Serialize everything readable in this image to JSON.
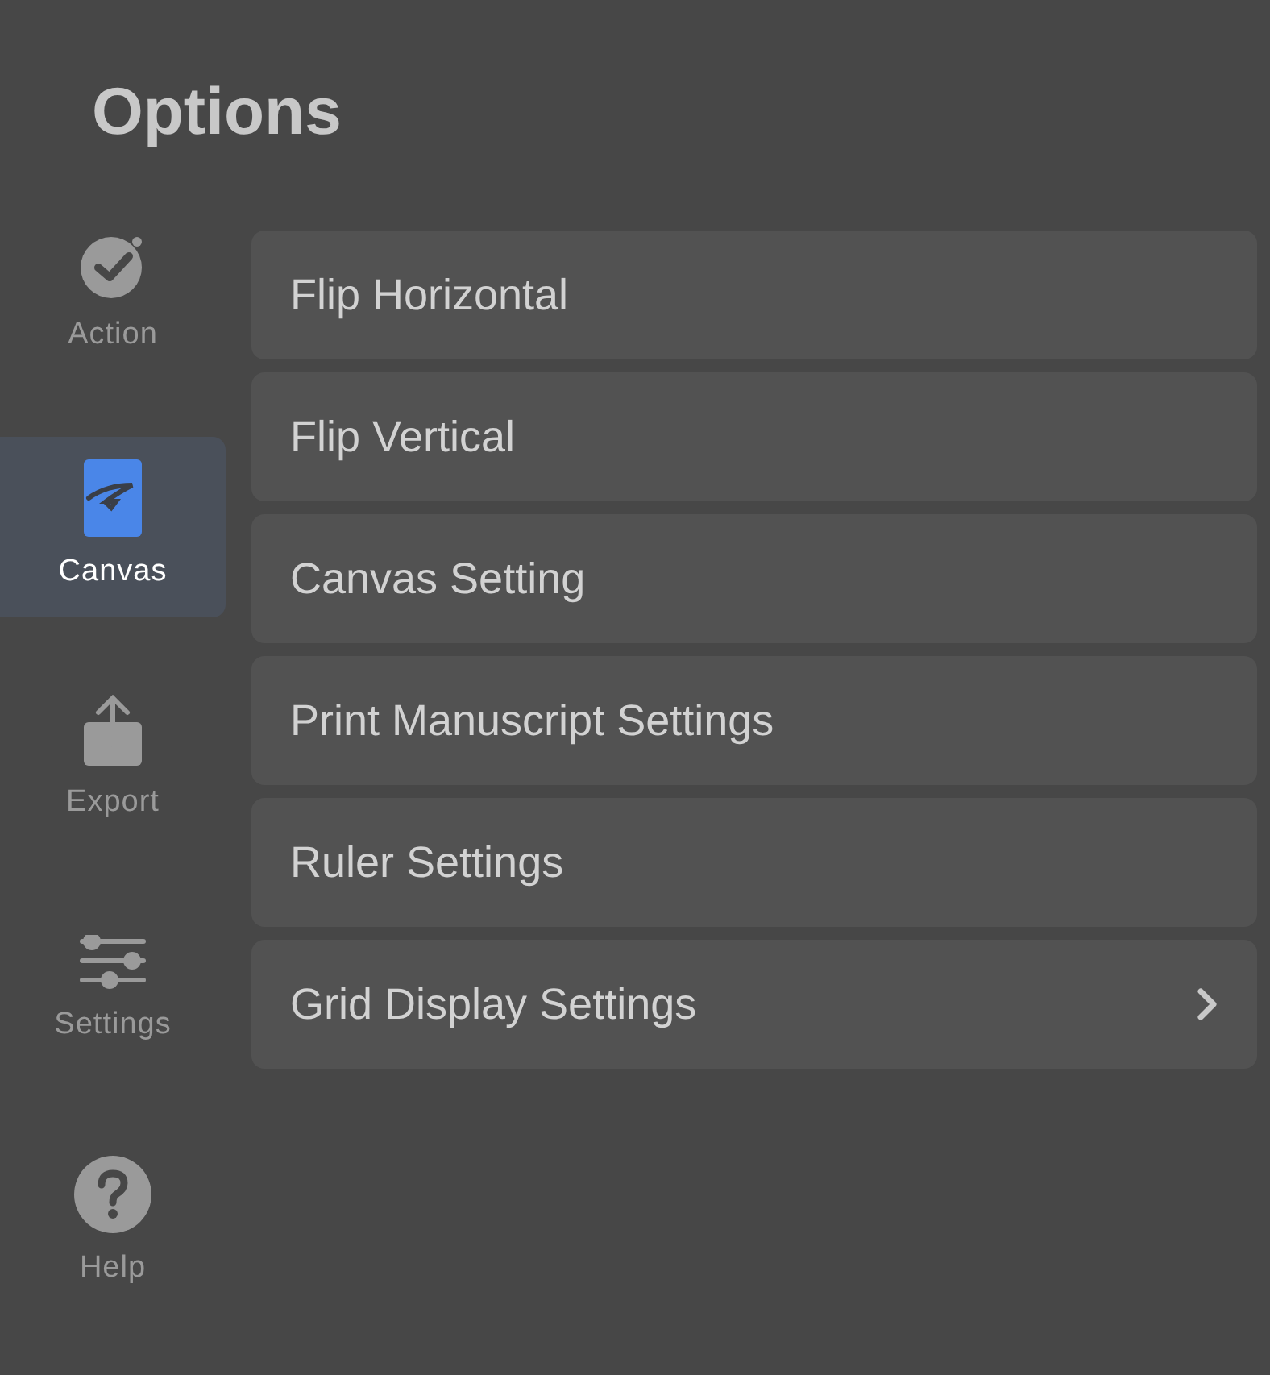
{
  "title": "Options",
  "sidebar": {
    "items": [
      {
        "label": "Action",
        "kind": "action",
        "selected": false
      },
      {
        "label": "Canvas",
        "kind": "canvas",
        "selected": true
      },
      {
        "label": "Export",
        "kind": "export",
        "selected": false
      },
      {
        "label": "Settings",
        "kind": "settings",
        "selected": false
      },
      {
        "label": "Help",
        "kind": "help",
        "selected": false
      }
    ]
  },
  "menu": [
    {
      "label": "Flip Horizontal",
      "submenu": false
    },
    {
      "label": "Flip Vertical",
      "submenu": false
    },
    {
      "label": "Canvas Setting",
      "submenu": false
    },
    {
      "label": "Print Manuscript Settings",
      "submenu": false
    },
    {
      "label": "Ruler Settings",
      "submenu": false
    },
    {
      "label": "Grid Display Settings",
      "submenu": true
    }
  ]
}
